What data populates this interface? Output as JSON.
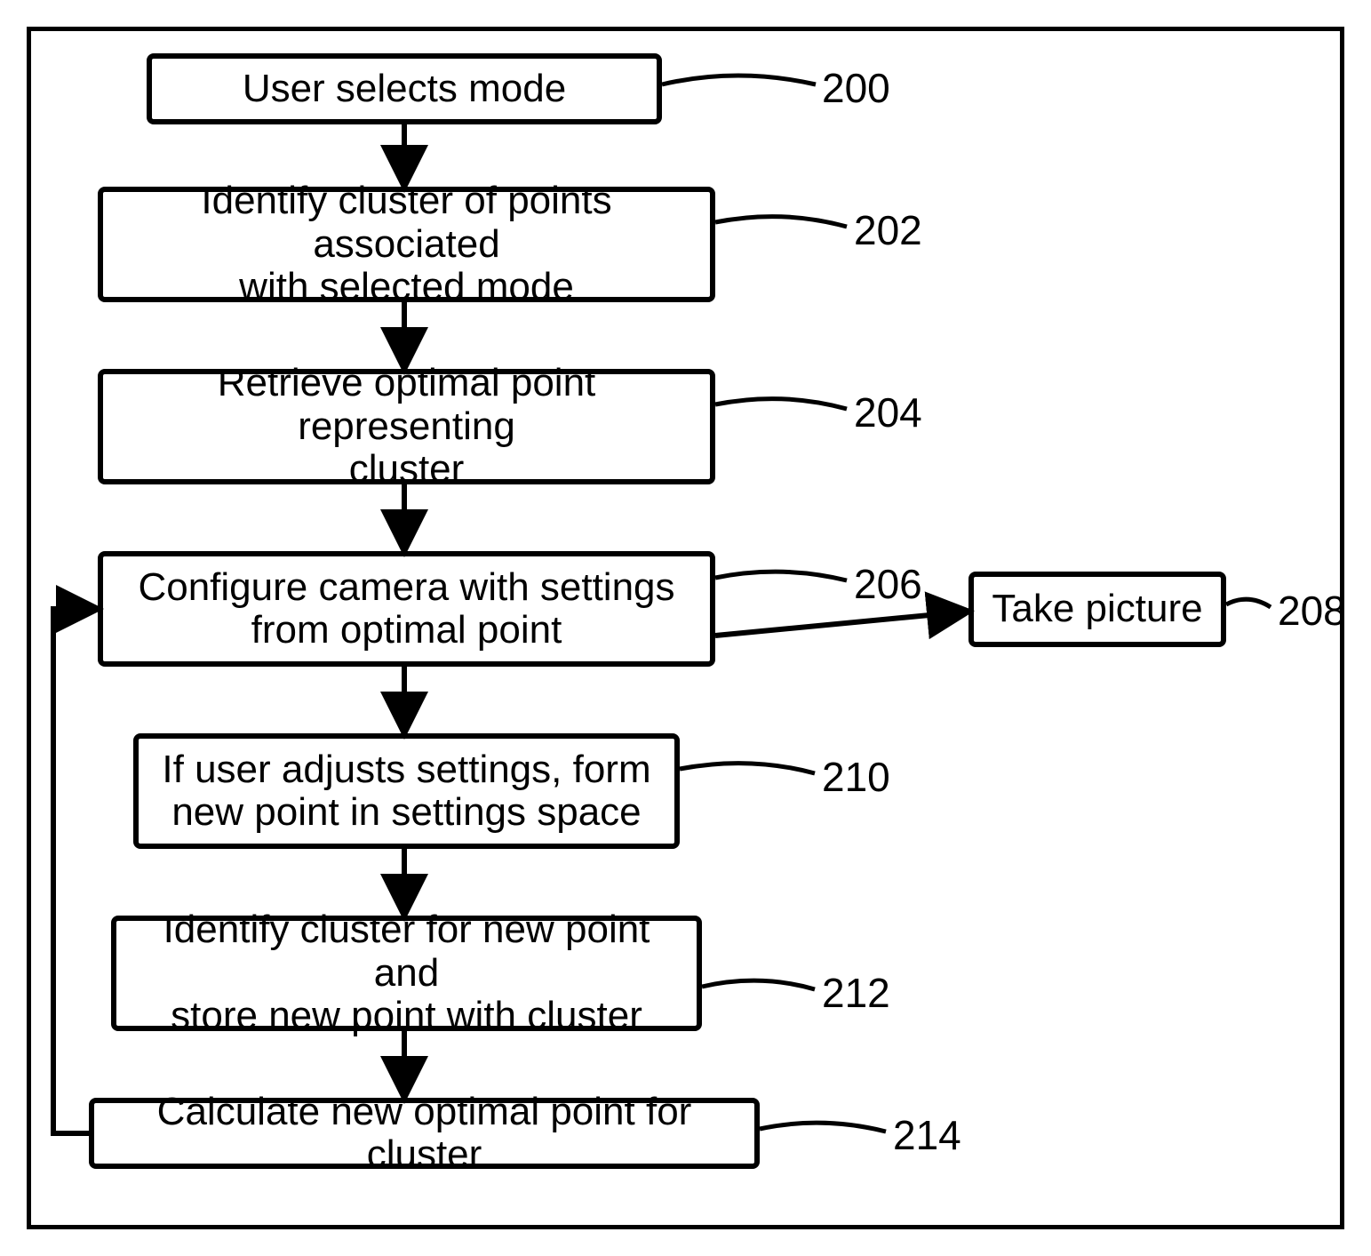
{
  "steps": {
    "s200": {
      "text": "User selects mode",
      "ref": "200"
    },
    "s202": {
      "text": "Identify cluster of points associated\nwith selected mode",
      "ref": "202"
    },
    "s204": {
      "text": "Retrieve optimal point representing\ncluster",
      "ref": "204"
    },
    "s206": {
      "text": "Configure camera with settings\nfrom optimal point",
      "ref": "206"
    },
    "s208": {
      "text": "Take picture",
      "ref": "208"
    },
    "s210": {
      "text": "If user adjusts settings, form\nnew point in settings space",
      "ref": "210"
    },
    "s212": {
      "text": "Identify cluster for new point and\nstore new point with cluster",
      "ref": "212"
    },
    "s214": {
      "text": "Calculate new optimal point for cluster",
      "ref": "214"
    }
  },
  "flow": {
    "edges": [
      [
        "s200",
        "s202"
      ],
      [
        "s202",
        "s204"
      ],
      [
        "s204",
        "s206"
      ],
      [
        "s206",
        "s208"
      ],
      [
        "s206",
        "s210"
      ],
      [
        "s210",
        "s212"
      ],
      [
        "s212",
        "s214"
      ],
      [
        "s214",
        "s206"
      ]
    ]
  }
}
